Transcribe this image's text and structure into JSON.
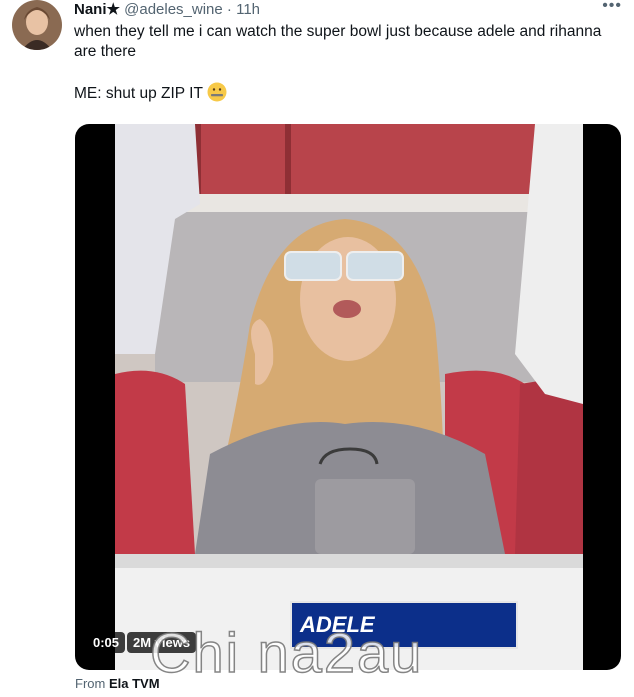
{
  "tweet": {
    "display_name": "Nani★",
    "handle": "@adeles_wine",
    "separator": "·",
    "time": "11h",
    "more_icon": "more-horizontal-icon",
    "text_line1": "when  they tell me i can watch the super bowl just because adele and rihanna are there",
    "text_line2": "ME: shut up ZIP IT",
    "emoji": "zipper-mouth-face"
  },
  "media": {
    "duration": "0:05",
    "views": "2M views",
    "overlay_caption": "ADELE"
  },
  "source": {
    "prefix": "From",
    "account": "Ela TVM"
  },
  "watermark": "Chi na2au",
  "colors": {
    "caption_bg": "#0c2f8a",
    "text_primary": "#0f1419",
    "text_muted": "#536471"
  }
}
